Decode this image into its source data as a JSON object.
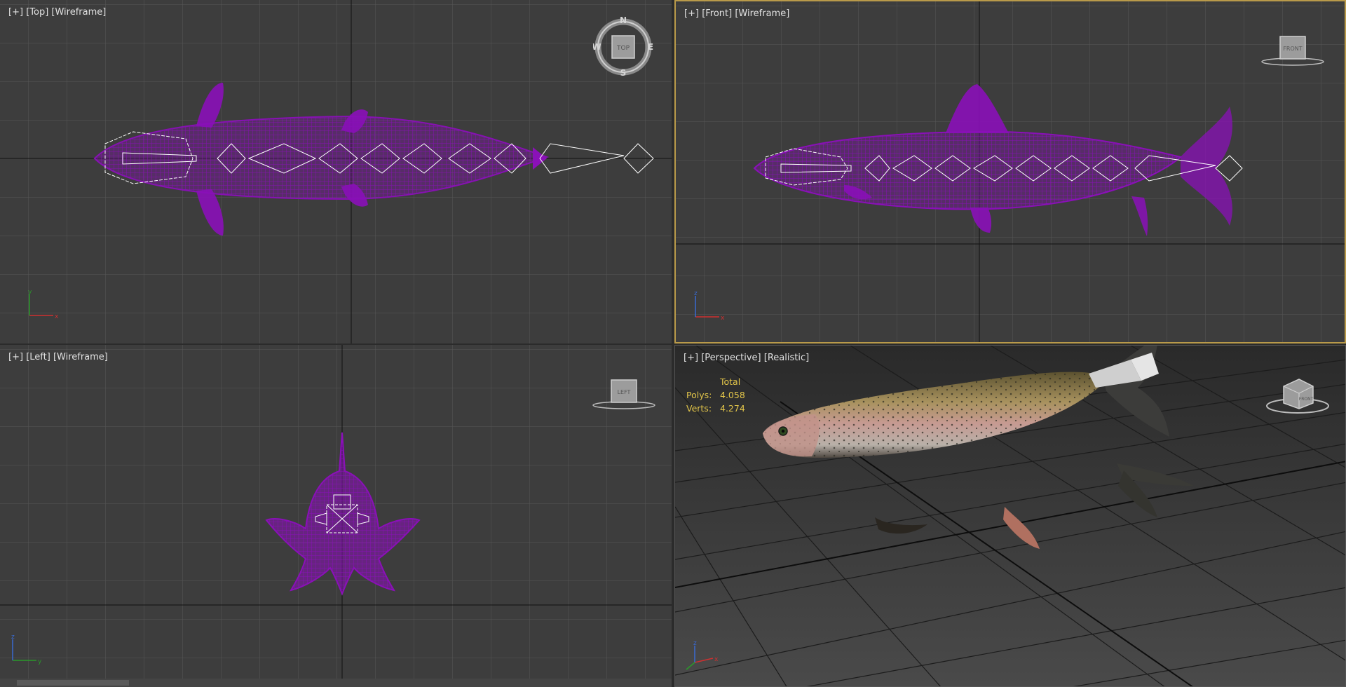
{
  "viewports": {
    "top": {
      "plus": "[+]",
      "view": "[Top]",
      "mode": "[Wireframe]",
      "cube": {
        "face": "TOP",
        "n": "N",
        "s": "S",
        "e": "E",
        "w": "W"
      },
      "axes": {
        "a": "x",
        "b": "y"
      }
    },
    "front": {
      "plus": "[+]",
      "view": "[Front]",
      "mode": "[Wireframe]",
      "cube": {
        "face": "FRONT"
      },
      "axes": {
        "a": "x",
        "b": "z"
      }
    },
    "left": {
      "plus": "[+]",
      "view": "[Left]",
      "mode": "[Wireframe]",
      "cube": {
        "face": "LEFT"
      },
      "axes": {
        "a": "y",
        "b": "z"
      }
    },
    "perspective": {
      "plus": "[+]",
      "view": "[Perspective]",
      "mode": "[Realistic]",
      "cube": {
        "face": "FRONT"
      },
      "axes": {
        "a": "x",
        "b": "z"
      },
      "stats": {
        "header": "Total",
        "polys_label": "Polys:",
        "polys_value": "4.058",
        "verts_label": "Verts:",
        "verts_value": "4.274"
      }
    }
  },
  "colors": {
    "viewport_bg": "#3d3d3d",
    "grid": "#575757",
    "wire": "#8a10b8",
    "bones": "#ffffff",
    "active_border": "#b99a4a",
    "stats_text": "#e3c64a"
  }
}
